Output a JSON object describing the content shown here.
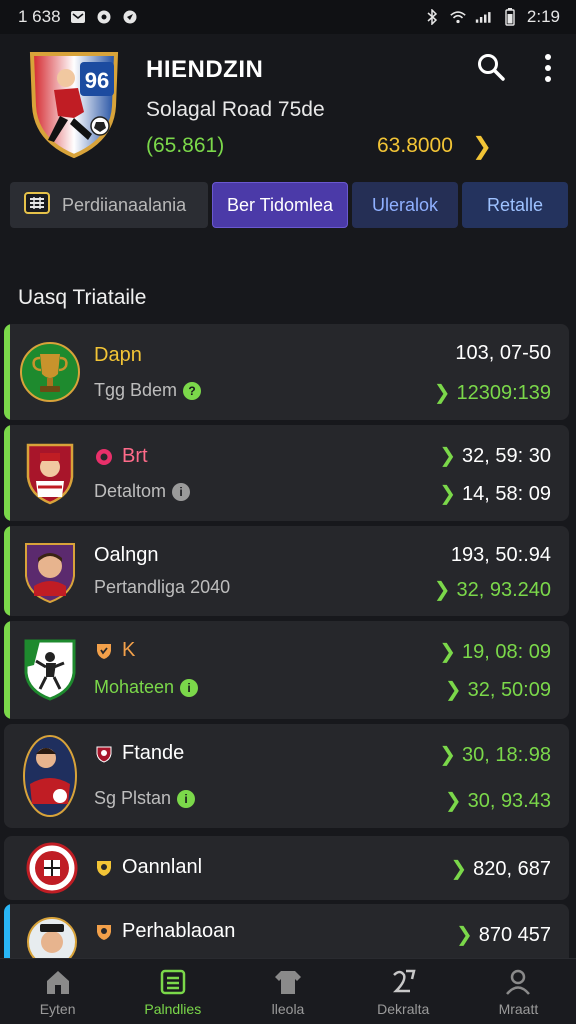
{
  "status_bar": {
    "time_left": "1 638",
    "time_right": "2:19"
  },
  "team": {
    "crest_number": "96",
    "name": "HIENDZIN",
    "subtitle": "Solagal Road 75de",
    "left_value": "(65.861)",
    "right_value": "63.8000"
  },
  "tabs": [
    {
      "label": "Perdiianaalania"
    },
    {
      "label": "Ber Tidomlea"
    },
    {
      "label": "Uleralok"
    },
    {
      "label": "Retalle"
    }
  ],
  "section_title": "Uasq Triataile",
  "rows": [
    {
      "name": "Dapn",
      "sub": "Tgg Bdem",
      "val1": "103, 07-50",
      "val2": "12309:139",
      "accent": "#7bd84a",
      "name_color": "#f2c436"
    },
    {
      "name": "Brt",
      "sub": "Detaltom",
      "val1": "32, 59: 30",
      "val2": "14, 58: 09",
      "accent": "#7bd84a",
      "name_color": "#ff6b8a"
    },
    {
      "name": "Oalngn",
      "sub": "Pertandliga 2040",
      "val1": "193, 50:.94",
      "val2": "32, 93.240",
      "accent": "#7bd84a",
      "name_color": "#ffffff"
    },
    {
      "name": "K",
      "sub": "Mohateen",
      "val1": "19, 08: 09",
      "val2": "32, 50:09",
      "accent": "#7bd84a",
      "name_color": "#f2a04a"
    },
    {
      "name": "Ftande",
      "sub": "Sg Plstan",
      "val1": "30, 18:.98",
      "val2": "30, 93.43",
      "accent": "#26272b",
      "name_color": "#ffffff"
    },
    {
      "name": "Oannlanl",
      "sub": "",
      "val1": "820, 687",
      "val2": "",
      "accent": "#26272b",
      "name_color": "#ffffff"
    },
    {
      "name": "Perhablaoan",
      "sub": "",
      "val1": "870  457",
      "val2": "",
      "accent": "#29b6f6",
      "name_color": "#ffffff"
    }
  ],
  "bottom_nav": [
    {
      "label": "Eyten"
    },
    {
      "label": "Palndlies"
    },
    {
      "label": "lleola"
    },
    {
      "label": "Dekralta"
    },
    {
      "label": "Mraatt"
    }
  ],
  "colors": {
    "accent_green": "#7bd84a",
    "accent_gold": "#f2c436",
    "tab_active": "#4b3aa8"
  }
}
